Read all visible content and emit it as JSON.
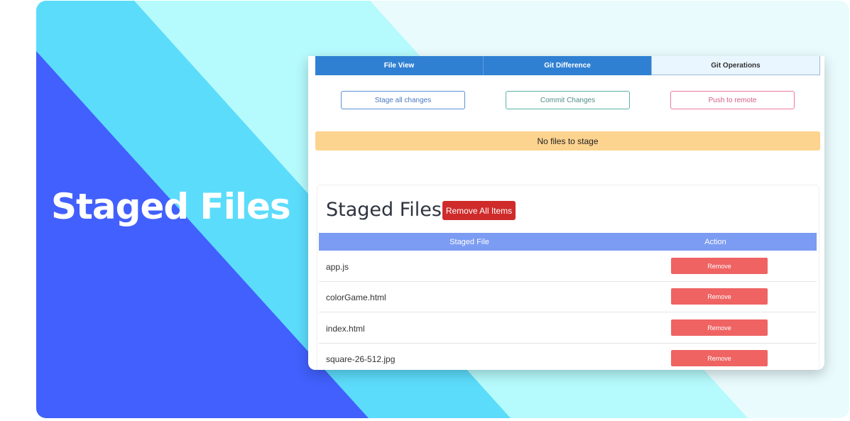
{
  "banner": {
    "title": "Staged Files",
    "colors": {
      "deep_blue": "#4160fd",
      "cyan": "#5cdcfb",
      "light_cyan": "#b5fafc",
      "pale": "#e9fbfd"
    }
  },
  "tabs": [
    {
      "label": "File View",
      "active": false
    },
    {
      "label": "Git Difference",
      "active": false
    },
    {
      "label": "Git Operations",
      "active": true
    }
  ],
  "operations": {
    "stage_label": "Stage all changes",
    "commit_label": "Commit Changes",
    "push_label": "Push to remote"
  },
  "notice": "No files to stage",
  "staged": {
    "heading": "Staged Files",
    "remove_all_label": "Remove All Items",
    "columns": [
      "Staged File",
      "Action"
    ],
    "rows": [
      {
        "file": "app.js",
        "action": "Remove"
      },
      {
        "file": "colorGame.html",
        "action": "Remove"
      },
      {
        "file": "index.html",
        "action": "Remove"
      },
      {
        "file": "square-26-512.jpg",
        "action": "Remove"
      }
    ]
  },
  "colors": {
    "tab_blue": "#2f80d2",
    "notice_bg": "#fcd38f",
    "remove_all_red": "#cf2b2b",
    "remove_red": "#ef6363",
    "table_header": "#7b9cf2"
  }
}
